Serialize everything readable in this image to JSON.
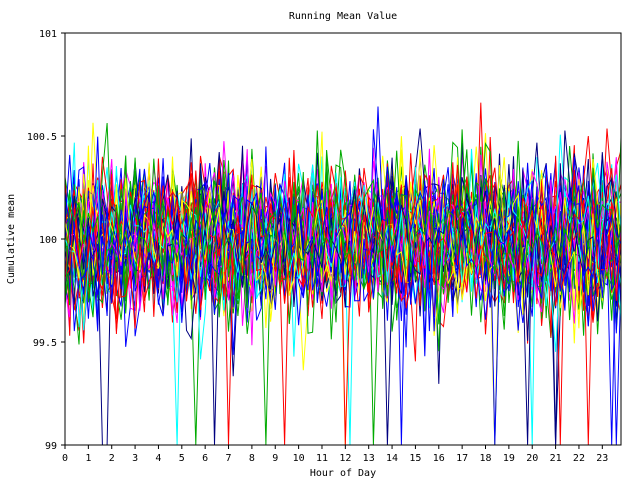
{
  "chart_data": {
    "type": "line",
    "title": "Running Mean Value",
    "xlabel": "Hour of Day",
    "ylabel": "Cumulative mean",
    "xlim": [
      0,
      23.8
    ],
    "ylim": [
      99,
      101
    ],
    "x_ticks": [
      "0",
      "1",
      "2",
      "3",
      "4",
      "5",
      "6",
      "7",
      "8",
      "9",
      "10",
      "11",
      "12",
      "13",
      "14",
      "15",
      "16",
      "17",
      "18",
      "19",
      "20",
      "21",
      "22",
      "23"
    ],
    "y_ticks": [
      "99",
      "99.5",
      "100",
      "100.5",
      "101"
    ],
    "grid": false,
    "legend": "none",
    "series_count": 60,
    "points_per_series": 120,
    "center": 100.0,
    "typical_band": [
      99.6,
      100.4
    ],
    "observed_max": 100.83,
    "observed_min": 99.0,
    "series_colors": [
      "#ff0000",
      "#00aa00",
      "#0000ff",
      "#ff00ff",
      "#00ffff",
      "#ffff00",
      "#000080",
      "#ff0000",
      "#0000ff",
      "#00aa00"
    ]
  }
}
